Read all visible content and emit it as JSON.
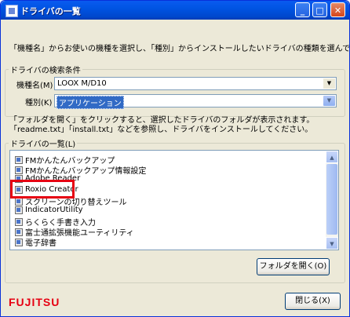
{
  "window": {
    "title": "ドライバの一覧"
  },
  "instruction": "「機種名」からお使いの機種を選択し、「種別」からインストールしたいドライバの種類を選んでください。",
  "search": {
    "legend": "ドライバの検索条件",
    "model_label": "機種名(M)",
    "model_value": "LOOX M/D10",
    "type_label": "種別(K)",
    "type_value": "アプリケーション"
  },
  "note": {
    "line1": "「フォルダを開く」をクリックすると、選択したドライバのフォルダが表示されます。",
    "line2": "「readme.txt」「install.txt」などを参照し、ドライバをインストールしてください。"
  },
  "driver_list": {
    "legend": "ドライバの一覧(L)",
    "items": [
      "FMかんたんバックアップ",
      "FMかんたんバックアップ情報設定",
      "Adobe Reader",
      "Roxio Creator",
      "スクリーンの切り替えツール",
      "IndicatorUtility",
      "らくらく手書き入力",
      "富士通拡張機能ユーティリティ",
      "電子辞書"
    ]
  },
  "buttons": {
    "open_folder": "フォルダを開く(O)",
    "close": "閉じる(X)"
  },
  "logo_text": "FUJITSU",
  "colors": {
    "highlight": "#e60012",
    "titlebar": "#0054e3",
    "selection": "#316ac5"
  },
  "icons": {
    "window": "app-icon",
    "item": "driver-icon"
  }
}
